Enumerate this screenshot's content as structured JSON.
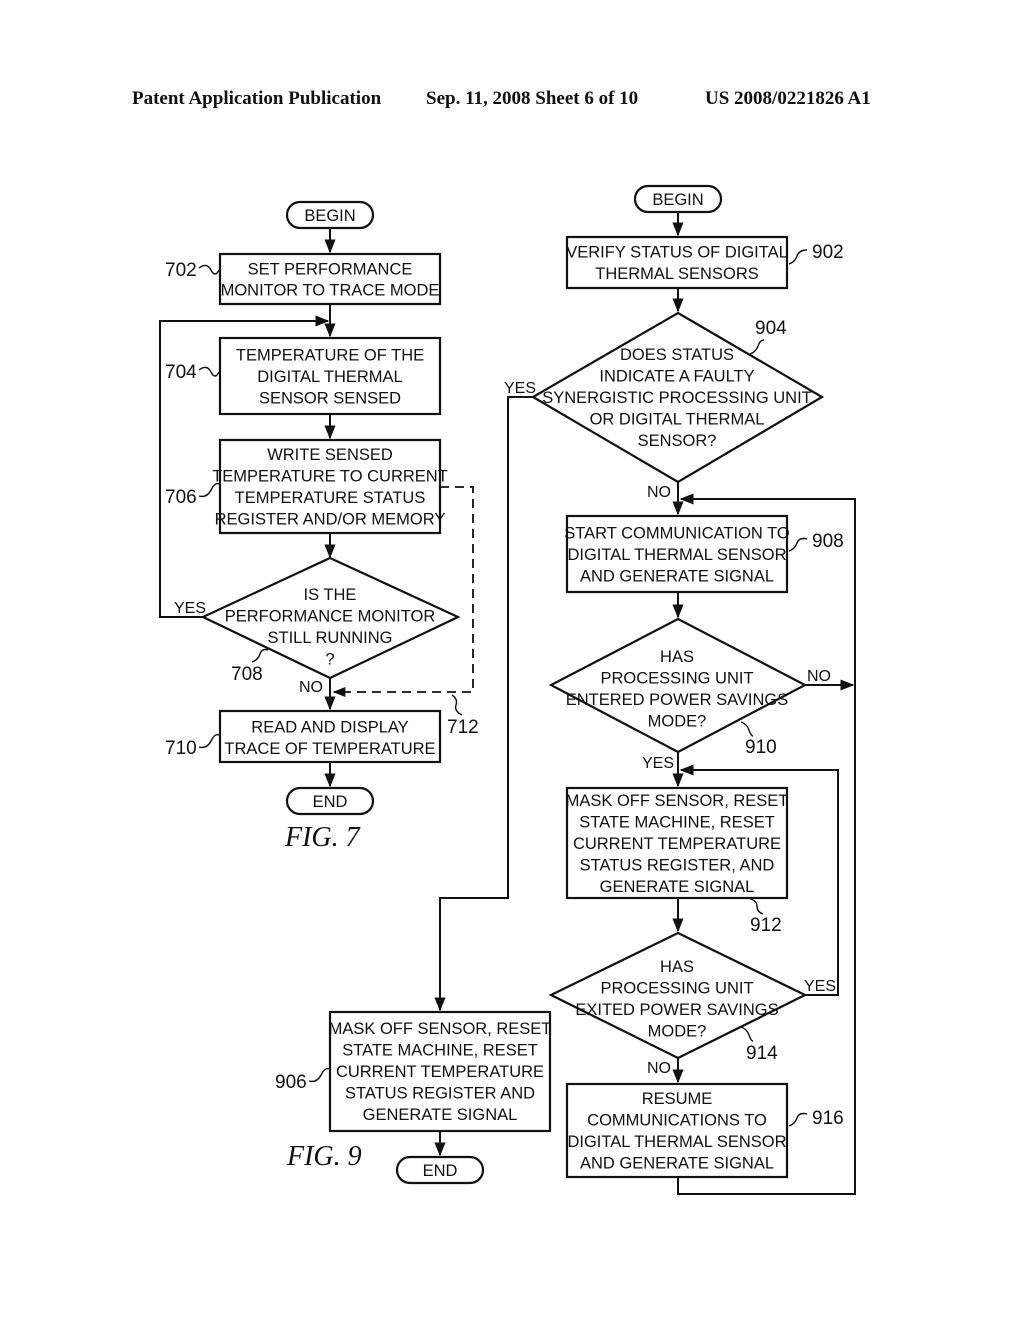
{
  "header": {
    "left": "Patent Application Publication",
    "date_sheet": "Sep. 11, 2008   Sheet 6 of 10",
    "number": "US 2008/0221826 A1"
  },
  "fig7": {
    "caption": "FIG. 7",
    "begin": "BEGIN",
    "end": "END",
    "steps": {
      "702": {
        "ref": "702",
        "lines": [
          "SET PERFORMANCE",
          "MONITOR TO TRACE MODE"
        ]
      },
      "704": {
        "ref": "704",
        "lines": [
          "TEMPERATURE OF THE",
          "DIGITAL THERMAL",
          "SENSOR SENSED"
        ]
      },
      "706": {
        "ref": "706",
        "lines": [
          "WRITE SENSED",
          "TEMPERATURE TO CURRENT",
          "TEMPERATURE STATUS",
          "REGISTER AND/OR MEMORY"
        ]
      },
      "708": {
        "ref": "708",
        "lines": [
          "IS THE",
          "PERFORMANCE MONITOR",
          "STILL RUNNING",
          "?"
        ],
        "yes": "YES",
        "no": "NO"
      },
      "710": {
        "ref": "710",
        "lines": [
          "READ AND DISPLAY",
          "TRACE OF TEMPERATURE"
        ]
      },
      "712": {
        "ref": "712"
      }
    }
  },
  "fig9": {
    "caption": "FIG. 9",
    "begin": "BEGIN",
    "end": "END",
    "steps": {
      "902": {
        "ref": "902",
        "lines": [
          "VERIFY STATUS OF DIGITAL",
          "THERMAL SENSORS"
        ]
      },
      "904": {
        "ref": "904",
        "lines": [
          "DOES STATUS",
          "INDICATE A FAULTY",
          "SYNERGISTIC PROCESSING UNIT",
          "OR DIGITAL THERMAL",
          "SENSOR?"
        ],
        "yes": "YES",
        "no": "NO"
      },
      "906": {
        "ref": "906",
        "lines": [
          "MASK OFF SENSOR, RESET",
          "STATE MACHINE, RESET",
          "CURRENT TEMPERATURE",
          "STATUS REGISTER AND",
          "GENERATE SIGNAL"
        ]
      },
      "908": {
        "ref": "908",
        "lines": [
          "START COMMUNICATION TO",
          "DIGITAL THERMAL SENSOR",
          "AND GENERATE SIGNAL"
        ]
      },
      "910": {
        "ref": "910",
        "lines": [
          "HAS",
          "PROCESSING UNIT",
          "ENTERED POWER SAVINGS",
          "MODE?"
        ],
        "yes": "YES",
        "no": "NO"
      },
      "912": {
        "ref": "912",
        "lines": [
          "MASK OFF SENSOR, RESET",
          "STATE MACHINE, RESET",
          "CURRENT TEMPERATURE",
          "STATUS REGISTER, AND",
          "GENERATE SIGNAL"
        ]
      },
      "914": {
        "ref": "914",
        "lines": [
          "HAS",
          "PROCESSING UNIT",
          "EXITED POWER SAVINGS",
          "MODE?"
        ],
        "yes": "YES",
        "no": "NO"
      },
      "916": {
        "ref": "916",
        "lines": [
          "RESUME",
          "COMMUNICATIONS TO",
          "DIGITAL THERMAL SENSOR",
          "AND GENERATE SIGNAL"
        ]
      }
    }
  }
}
